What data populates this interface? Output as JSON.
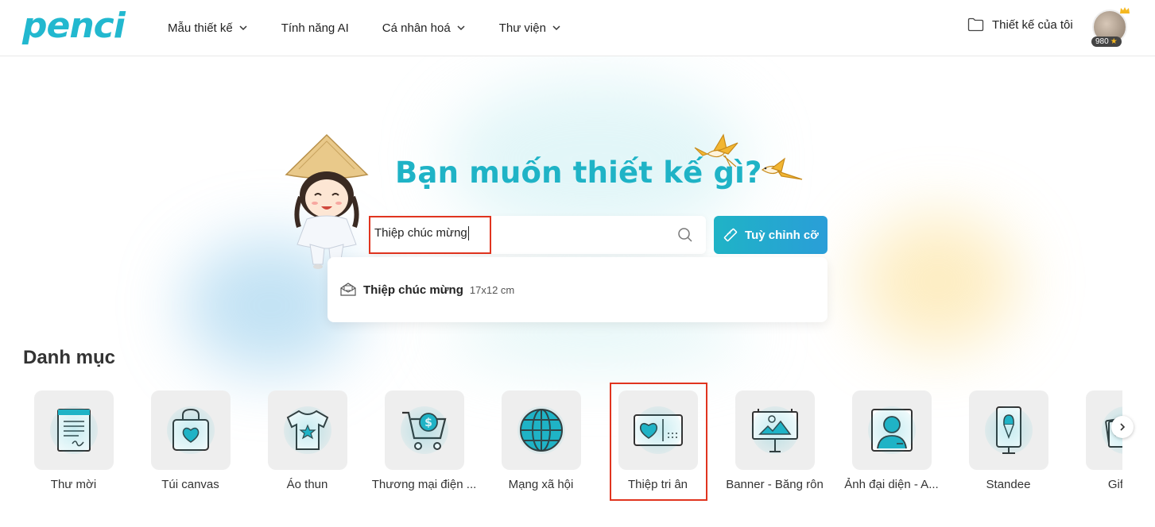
{
  "header": {
    "logo": "penci",
    "nav": [
      {
        "label": "Mẫu thiết kế",
        "has_dropdown": true
      },
      {
        "label": "Tính năng AI",
        "has_dropdown": false
      },
      {
        "label": "Cá nhân hoá",
        "has_dropdown": true
      },
      {
        "label": "Thư viện",
        "has_dropdown": true
      }
    ],
    "my_designs": "Thiết kế của tôi",
    "points": "980"
  },
  "hero": {
    "title": "Bạn muốn thiết kế gì?",
    "search_value": "Thiệp chúc mừng",
    "custom_size_label": "Tuỳ chỉnh cỡ"
  },
  "dropdown": {
    "suggestions": [
      {
        "title": "Thiệp chúc mừng",
        "size": "17x12 cm",
        "icon": "envelope-icon"
      }
    ]
  },
  "categories": {
    "title": "Danh mục",
    "items": [
      {
        "label": "Thư mời",
        "icon": "invitation-icon"
      },
      {
        "label": "Túi canvas",
        "icon": "tote-bag-icon"
      },
      {
        "label": "Áo thun",
        "icon": "tshirt-icon"
      },
      {
        "label": "Thương mại điện ...",
        "icon": "shopping-cart-icon"
      },
      {
        "label": "Mạng xã hội",
        "icon": "globe-icon"
      },
      {
        "label": "Thiệp tri ân",
        "icon": "thank-you-card-icon"
      },
      {
        "label": "Banner - Băng rôn",
        "icon": "billboard-icon"
      },
      {
        "label": "Ảnh đại diện - A...",
        "icon": "avatar-icon"
      },
      {
        "label": "Standee",
        "icon": "standee-icon"
      },
      {
        "label": "Gift vo",
        "icon": "gift-voucher-icon"
      }
    ]
  },
  "colors": {
    "brand": "#1fb3c6",
    "highlight": "#e0341f"
  }
}
